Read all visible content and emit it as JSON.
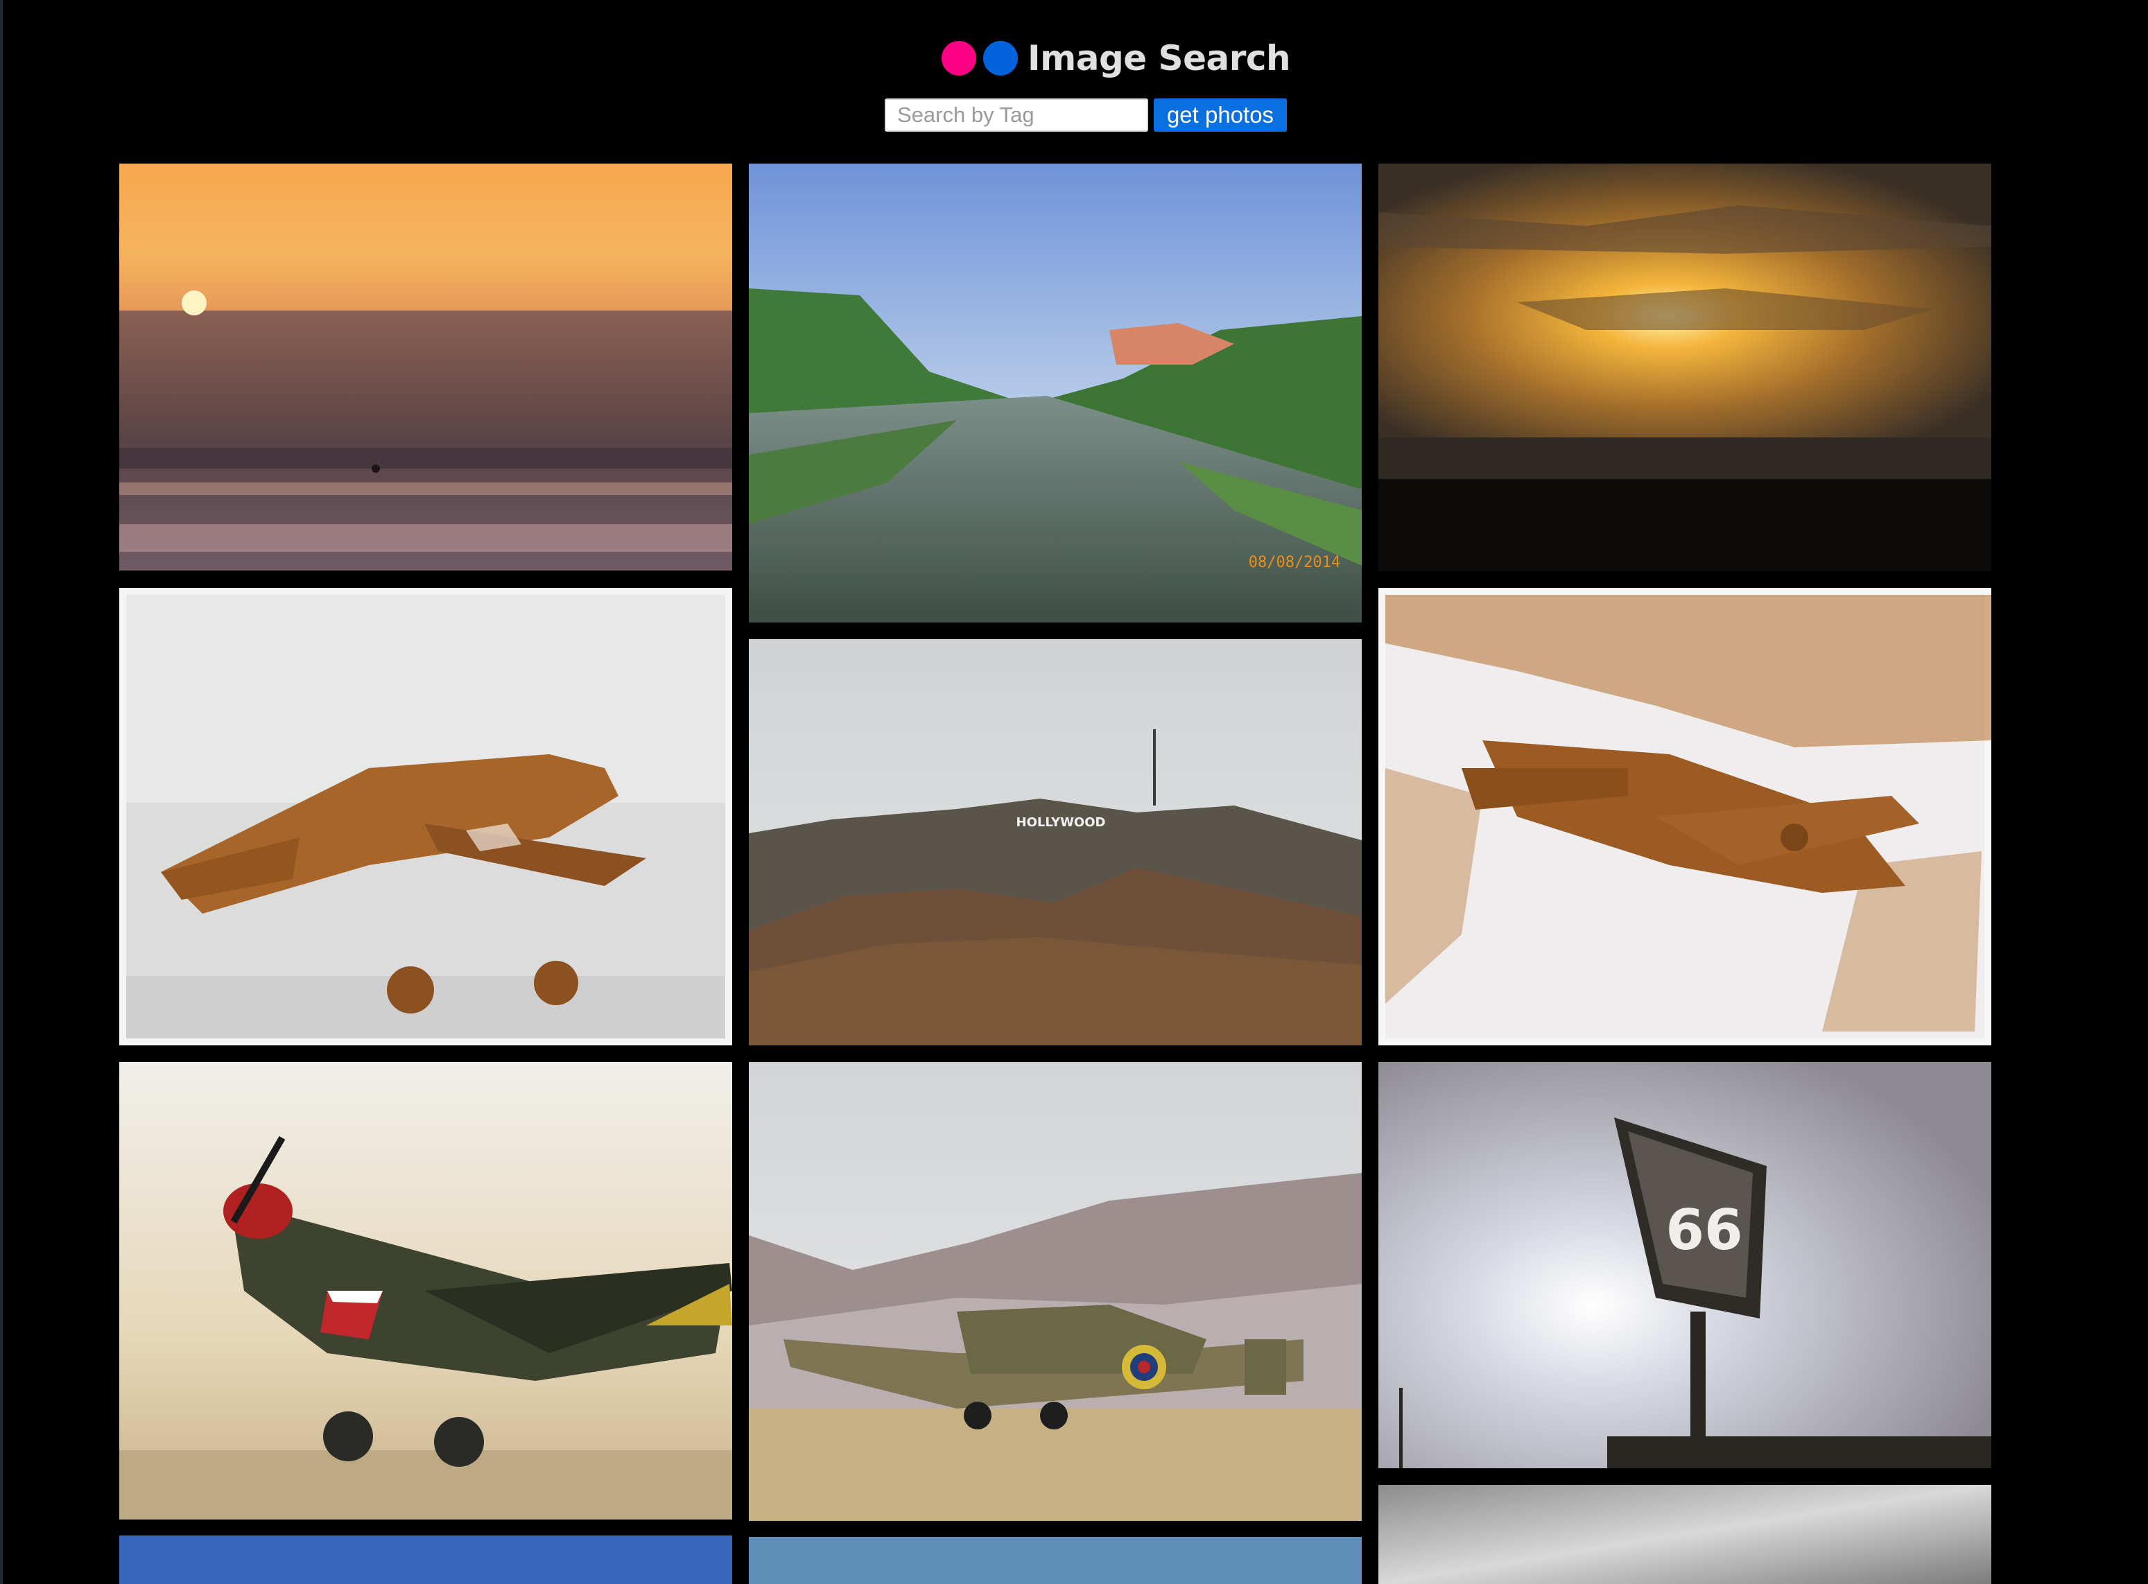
{
  "header": {
    "title": "Image Search",
    "logo_dots": [
      {
        "name": "pink",
        "color": "#ff0084"
      },
      {
        "name": "blue",
        "color": "#0063dc"
      }
    ]
  },
  "search": {
    "placeholder": "Search by Tag",
    "value": "",
    "button_label": "get photos",
    "button_color": "#0a6fe0"
  },
  "theme": {
    "background": "#000000"
  },
  "photos": [
    {
      "subject": "ocean-sunset",
      "caption": ""
    },
    {
      "subject": "venice-canal",
      "caption": "08/08/2014"
    },
    {
      "subject": "sunset-rays",
      "caption": ""
    },
    {
      "subject": "sepia-p40-warhawk",
      "caption": ""
    },
    {
      "subject": "hollywood-sign",
      "caption": "HOLLYWOOD"
    },
    {
      "subject": "sepia-spitfire",
      "caption": ""
    },
    {
      "subject": "p40-sharkmouth-model",
      "caption": ""
    },
    {
      "subject": "spitfire-model-mountains",
      "caption": ""
    },
    {
      "subject": "route-66-sign",
      "caption": "66"
    },
    {
      "subject": "partial-blue-sky",
      "caption": ""
    },
    {
      "subject": "partial-blue-sky-2",
      "caption": ""
    },
    {
      "subject": "partial-cloudy-sky",
      "caption": ""
    }
  ]
}
